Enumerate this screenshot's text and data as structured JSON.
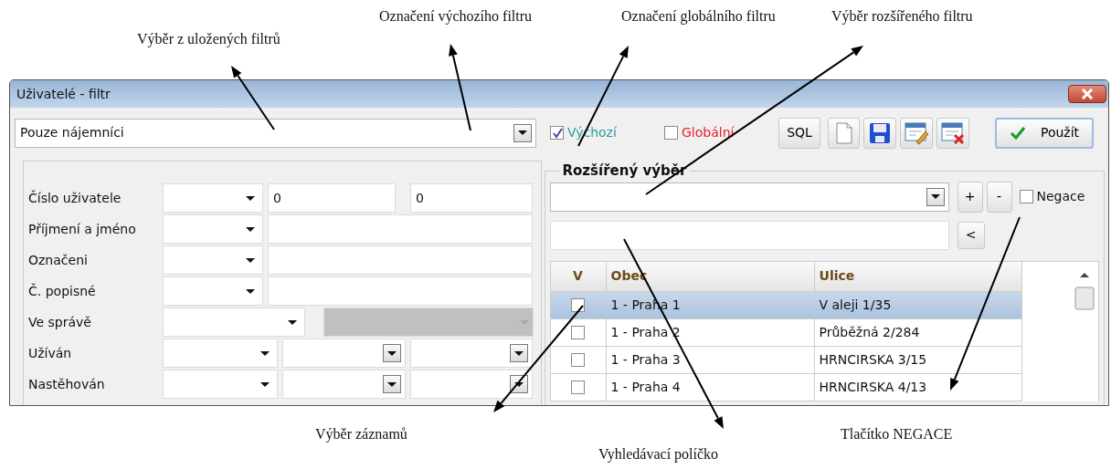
{
  "annotations": [
    {
      "text": "Výběr z uložených filtrů"
    },
    {
      "text": "Označení výchozího filtru"
    },
    {
      "text": "Označení globálního filtru"
    },
    {
      "text": "Výběr rozšířeného filtru"
    },
    {
      "text": "Výběr záznamů"
    },
    {
      "text": "Vyhledávací políčko"
    },
    {
      "text": "Tlačítko NEGACE"
    }
  ],
  "window": {
    "title": "Uživatelé - filtr"
  },
  "saved_filter": {
    "value": "Pouze nájemníci"
  },
  "default_filter": {
    "label": "Výchozí",
    "checked": true
  },
  "global_filter": {
    "label": "Globální",
    "checked": false
  },
  "toolbar": [
    {
      "kind": "text",
      "label": "SQL"
    },
    {
      "kind": "new"
    },
    {
      "kind": "save"
    },
    {
      "kind": "edit"
    },
    {
      "kind": "delete"
    }
  ],
  "apply_button": {
    "label": "Použít"
  },
  "conditions": [
    {
      "label": "Číslo uživatele",
      "kind": "range",
      "values": [
        "0",
        "0"
      ]
    },
    {
      "label": "Příjmení a jméno",
      "kind": "text"
    },
    {
      "label": "Označeni",
      "kind": "text"
    },
    {
      "label": "Č. popisné",
      "kind": "text"
    },
    {
      "label": "Ve správě",
      "kind": "disabled"
    },
    {
      "label": "Užíván",
      "kind": "triple"
    },
    {
      "label": "Nastěhován",
      "kind": "triple"
    }
  ],
  "extended": {
    "title": "Rozšířený výběr",
    "add": "+",
    "remove": "-",
    "negate": {
      "label": "Negace",
      "checked": false
    },
    "back": "<",
    "check_column": "V",
    "columns": [
      "Obec",
      "Ulice"
    ],
    "rows": [
      {
        "selected": true,
        "checked": false,
        "cells": [
          "1 - Praha 1",
          "V aleji 1/35"
        ]
      },
      {
        "selected": false,
        "checked": false,
        "cells": [
          "1 - Praha 2",
          "Průběžná 2/284"
        ]
      },
      {
        "selected": false,
        "checked": false,
        "cells": [
          "1 - Praha 3",
          "HRNCIRSKA 3/15"
        ]
      },
      {
        "selected": false,
        "checked": false,
        "cells": [
          "1 - Praha 4",
          "HRNCIRSKA 4/13"
        ]
      }
    ]
  }
}
